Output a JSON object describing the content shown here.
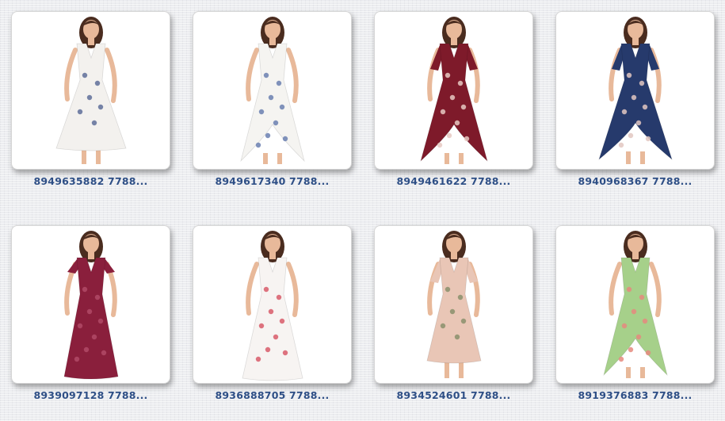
{
  "gallery": {
    "items": [
      {
        "caption": "8949635882 7788...",
        "image": "white-floral-wrap-mini-dress",
        "dress_color": "#f3f1ee",
        "print_color": "#5e6f99"
      },
      {
        "caption": "8949617340 7788...",
        "image": "white-floral-high-low-maxi-dress",
        "dress_color": "#f5f4f1",
        "print_color": "#6a7fb0"
      },
      {
        "caption": "8949461622 7788...",
        "image": "burgundy-floral-bell-sleeve-maxi-dress",
        "dress_color": "#7e1a2a",
        "print_color": "#e6c9c2"
      },
      {
        "caption": "8940968367 7788...",
        "image": "navy-floral-bell-sleeve-maxi-dress",
        "dress_color": "#263a6c",
        "print_color": "#e2c7c1"
      },
      {
        "caption": "8939097128 7788...",
        "image": "wine-lace-deep-v-maxi-dress",
        "dress_color": "#8a1f3c",
        "print_color": "#b04a66"
      },
      {
        "caption": "8936888705 7788...",
        "image": "white-rose-print-maxi-dress",
        "dress_color": "#f7f4f2",
        "print_color": "#d85a6a"
      },
      {
        "caption": "8934524601 7788...",
        "image": "pink-floral-shift-mini-dress",
        "dress_color": "#e9c6b6",
        "print_color": "#8a8f6c"
      },
      {
        "caption": "8919376883 7788...",
        "image": "green-floral-halter-maxi-dress",
        "dress_color": "#a6d08a",
        "print_color": "#e58a7e"
      }
    ]
  }
}
